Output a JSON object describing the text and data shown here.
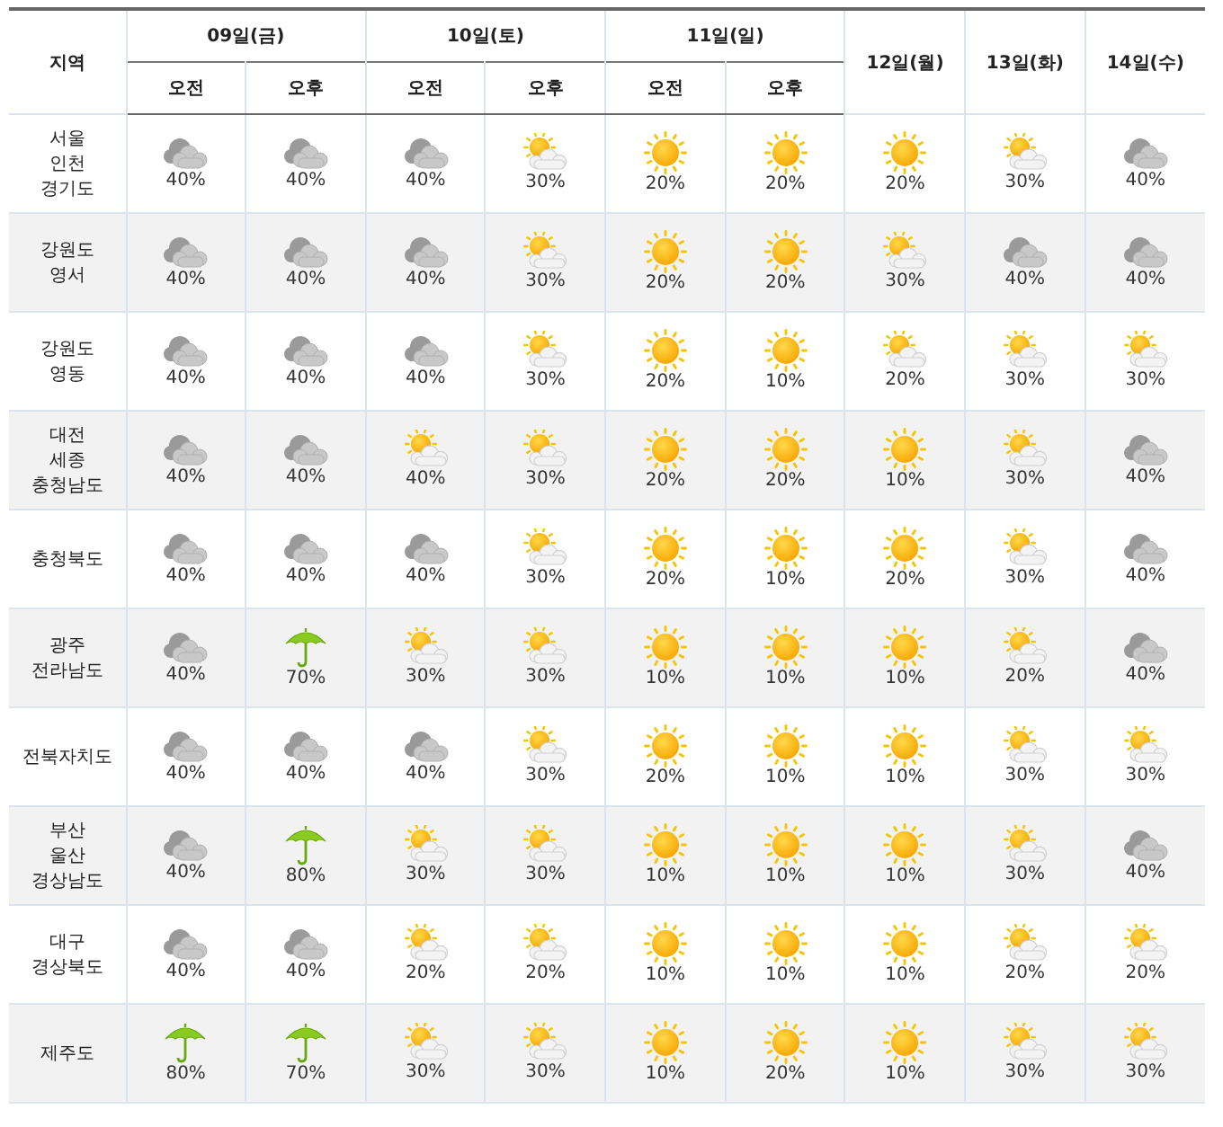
{
  "table": {
    "region_header": "지역",
    "days": [
      {
        "label": "09일(금)",
        "halves": [
          "오전",
          "오후"
        ]
      },
      {
        "label": "10일(토)",
        "halves": [
          "오전",
          "오후"
        ]
      },
      {
        "label": "11일(일)",
        "halves": [
          "오전",
          "오후"
        ]
      },
      {
        "label": "12일(월)"
      },
      {
        "label": "13일(화)"
      },
      {
        "label": "14일(수)"
      }
    ],
    "rows": [
      {
        "region": "서울\n인천\n경기도",
        "cells": [
          {
            "kind": "cloudy",
            "rain_chance": "40%"
          },
          {
            "kind": "cloudy",
            "rain_chance": "40%"
          },
          {
            "kind": "cloudy",
            "rain_chance": "40%"
          },
          {
            "kind": "partly_cloudy",
            "rain_chance": "30%"
          },
          {
            "kind": "sunny",
            "rain_chance": "20%"
          },
          {
            "kind": "sunny",
            "rain_chance": "20%"
          },
          {
            "kind": "sunny",
            "rain_chance": "20%"
          },
          {
            "kind": "partly_cloudy",
            "rain_chance": "30%"
          },
          {
            "kind": "cloudy",
            "rain_chance": "40%"
          }
        ]
      },
      {
        "region": "강원도\n영서",
        "cells": [
          {
            "kind": "cloudy",
            "rain_chance": "40%"
          },
          {
            "kind": "cloudy",
            "rain_chance": "40%"
          },
          {
            "kind": "cloudy",
            "rain_chance": "40%"
          },
          {
            "kind": "partly_cloudy",
            "rain_chance": "30%"
          },
          {
            "kind": "sunny",
            "rain_chance": "20%"
          },
          {
            "kind": "sunny",
            "rain_chance": "20%"
          },
          {
            "kind": "partly_cloudy",
            "rain_chance": "30%"
          },
          {
            "kind": "cloudy",
            "rain_chance": "40%"
          },
          {
            "kind": "cloudy",
            "rain_chance": "40%"
          }
        ]
      },
      {
        "region": "강원도\n영동",
        "cells": [
          {
            "kind": "cloudy",
            "rain_chance": "40%"
          },
          {
            "kind": "cloudy",
            "rain_chance": "40%"
          },
          {
            "kind": "cloudy",
            "rain_chance": "40%"
          },
          {
            "kind": "partly_cloudy",
            "rain_chance": "30%"
          },
          {
            "kind": "sunny",
            "rain_chance": "20%"
          },
          {
            "kind": "sunny",
            "rain_chance": "10%"
          },
          {
            "kind": "partly_cloudy",
            "rain_chance": "20%"
          },
          {
            "kind": "partly_cloudy",
            "rain_chance": "30%"
          },
          {
            "kind": "partly_cloudy",
            "rain_chance": "30%"
          }
        ]
      },
      {
        "region": "대전\n세종\n충청남도",
        "cells": [
          {
            "kind": "cloudy",
            "rain_chance": "40%"
          },
          {
            "kind": "cloudy",
            "rain_chance": "40%"
          },
          {
            "kind": "partly_cloudy",
            "rain_chance": "40%"
          },
          {
            "kind": "partly_cloudy",
            "rain_chance": "30%"
          },
          {
            "kind": "sunny",
            "rain_chance": "20%"
          },
          {
            "kind": "sunny",
            "rain_chance": "20%"
          },
          {
            "kind": "sunny",
            "rain_chance": "10%"
          },
          {
            "kind": "partly_cloudy",
            "rain_chance": "30%"
          },
          {
            "kind": "cloudy",
            "rain_chance": "40%"
          }
        ]
      },
      {
        "region": "충청북도",
        "cells": [
          {
            "kind": "cloudy",
            "rain_chance": "40%"
          },
          {
            "kind": "cloudy",
            "rain_chance": "40%"
          },
          {
            "kind": "cloudy",
            "rain_chance": "40%"
          },
          {
            "kind": "partly_cloudy",
            "rain_chance": "30%"
          },
          {
            "kind": "sunny",
            "rain_chance": "20%"
          },
          {
            "kind": "sunny",
            "rain_chance": "10%"
          },
          {
            "kind": "sunny",
            "rain_chance": "20%"
          },
          {
            "kind": "partly_cloudy",
            "rain_chance": "30%"
          },
          {
            "kind": "cloudy",
            "rain_chance": "40%"
          }
        ]
      },
      {
        "region": "광주\n전라남도",
        "cells": [
          {
            "kind": "cloudy",
            "rain_chance": "40%"
          },
          {
            "kind": "rain",
            "rain_chance": "70%"
          },
          {
            "kind": "partly_cloudy",
            "rain_chance": "30%"
          },
          {
            "kind": "partly_cloudy",
            "rain_chance": "30%"
          },
          {
            "kind": "sunny",
            "rain_chance": "10%"
          },
          {
            "kind": "sunny",
            "rain_chance": "10%"
          },
          {
            "kind": "sunny",
            "rain_chance": "10%"
          },
          {
            "kind": "partly_cloudy",
            "rain_chance": "20%"
          },
          {
            "kind": "cloudy",
            "rain_chance": "40%"
          }
        ]
      },
      {
        "region": "전북자치도",
        "cells": [
          {
            "kind": "cloudy",
            "rain_chance": "40%"
          },
          {
            "kind": "cloudy",
            "rain_chance": "40%"
          },
          {
            "kind": "cloudy",
            "rain_chance": "40%"
          },
          {
            "kind": "partly_cloudy",
            "rain_chance": "30%"
          },
          {
            "kind": "sunny",
            "rain_chance": "20%"
          },
          {
            "kind": "sunny",
            "rain_chance": "10%"
          },
          {
            "kind": "sunny",
            "rain_chance": "10%"
          },
          {
            "kind": "partly_cloudy",
            "rain_chance": "30%"
          },
          {
            "kind": "partly_cloudy",
            "rain_chance": "30%"
          }
        ]
      },
      {
        "region": "부산\n울산\n경상남도",
        "cells": [
          {
            "kind": "cloudy",
            "rain_chance": "40%"
          },
          {
            "kind": "rain",
            "rain_chance": "80%"
          },
          {
            "kind": "partly_cloudy",
            "rain_chance": "30%"
          },
          {
            "kind": "partly_cloudy",
            "rain_chance": "30%"
          },
          {
            "kind": "sunny",
            "rain_chance": "10%"
          },
          {
            "kind": "sunny",
            "rain_chance": "10%"
          },
          {
            "kind": "sunny",
            "rain_chance": "10%"
          },
          {
            "kind": "partly_cloudy",
            "rain_chance": "30%"
          },
          {
            "kind": "cloudy",
            "rain_chance": "40%"
          }
        ]
      },
      {
        "region": "대구\n경상북도",
        "cells": [
          {
            "kind": "cloudy",
            "rain_chance": "40%"
          },
          {
            "kind": "cloudy",
            "rain_chance": "40%"
          },
          {
            "kind": "partly_cloudy",
            "rain_chance": "20%"
          },
          {
            "kind": "partly_cloudy",
            "rain_chance": "20%"
          },
          {
            "kind": "sunny",
            "rain_chance": "10%"
          },
          {
            "kind": "sunny",
            "rain_chance": "10%"
          },
          {
            "kind": "sunny",
            "rain_chance": "10%"
          },
          {
            "kind": "partly_cloudy",
            "rain_chance": "20%"
          },
          {
            "kind": "partly_cloudy",
            "rain_chance": "20%"
          }
        ]
      },
      {
        "region": "제주도",
        "cells": [
          {
            "kind": "rain",
            "rain_chance": "80%"
          },
          {
            "kind": "rain",
            "rain_chance": "70%"
          },
          {
            "kind": "partly_cloudy",
            "rain_chance": "30%"
          },
          {
            "kind": "partly_cloudy",
            "rain_chance": "30%"
          },
          {
            "kind": "sunny",
            "rain_chance": "10%"
          },
          {
            "kind": "sunny",
            "rain_chance": "20%"
          },
          {
            "kind": "sunny",
            "rain_chance": "10%"
          },
          {
            "kind": "partly_cloudy",
            "rain_chance": "30%"
          },
          {
            "kind": "partly_cloudy",
            "rain_chance": "30%"
          }
        ]
      }
    ]
  }
}
